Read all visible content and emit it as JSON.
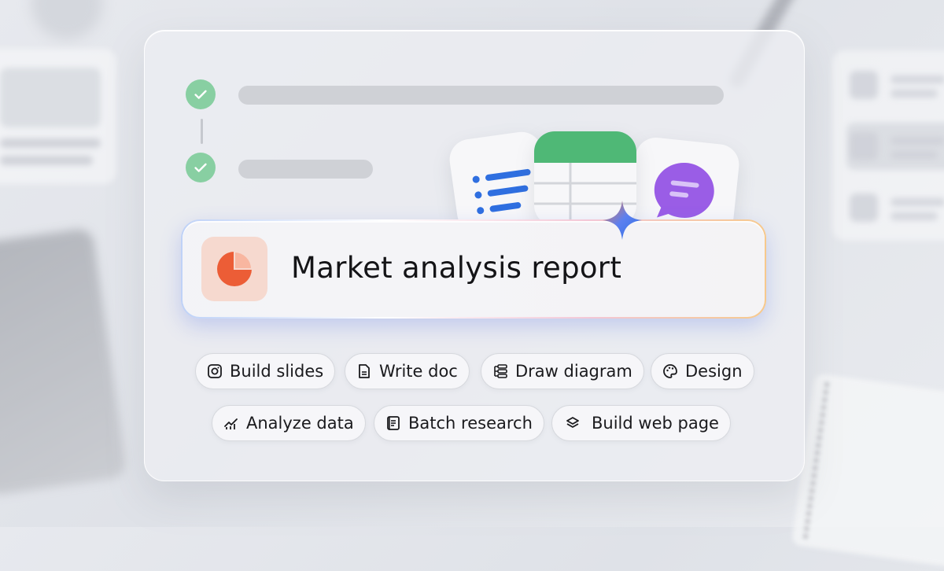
{
  "prompt": {
    "text": "Market analysis report",
    "icon": "pie-chart-icon"
  },
  "progress": {
    "steps": [
      {
        "status": "done"
      },
      {
        "status": "done"
      }
    ]
  },
  "apps": [
    {
      "icon": "document-list-icon"
    },
    {
      "icon": "spreadsheet-icon"
    },
    {
      "icon": "chat-bubble-icon"
    }
  ],
  "chips": {
    "row1": [
      {
        "label": "Build slides",
        "icon": "slides-icon"
      },
      {
        "label": "Write doc",
        "icon": "doc-icon"
      },
      {
        "label": "Draw diagram",
        "icon": "diagram-icon"
      },
      {
        "label": "Design",
        "icon": "palette-icon"
      }
    ],
    "row2": [
      {
        "label": "Analyze data",
        "icon": "chart-icon"
      },
      {
        "label": "Batch research",
        "icon": "research-icon"
      },
      {
        "label": "Build web page",
        "icon": "layers-icon"
      }
    ]
  },
  "colors": {
    "check": "#88cfa2",
    "pie": "#ec5d36",
    "sheet_header": "#4fb876",
    "chat": "#9a5de6",
    "doc_lines": "#2f6fe0"
  }
}
